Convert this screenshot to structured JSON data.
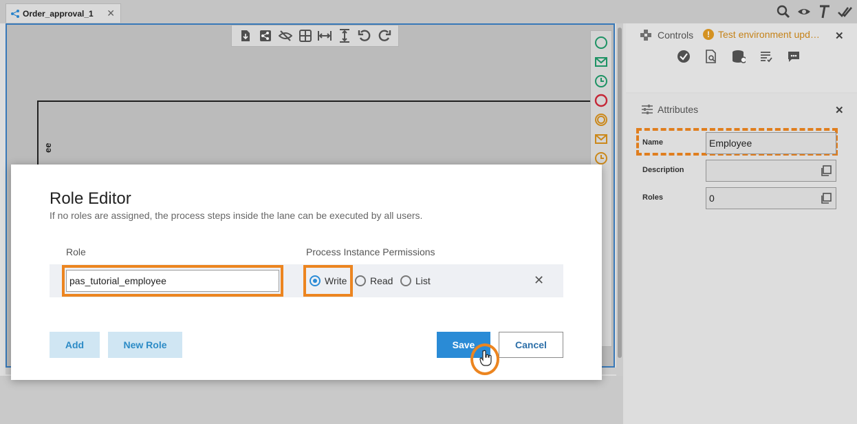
{
  "tab": {
    "title": "Order_approval_1",
    "close": "✕"
  },
  "canvas": {
    "lane_label": "ee"
  },
  "controls": {
    "title": "Controls",
    "notice": "Test environment upd…",
    "close": "✕"
  },
  "attributes": {
    "title": "Attributes",
    "close": "✕",
    "name_label": "Name",
    "name_value": "Employee",
    "description_label": "Description",
    "description_value": "",
    "roles_label": "Roles",
    "roles_value": "0"
  },
  "dialog": {
    "title": "Role Editor",
    "subtitle": "If no roles are assigned, the process steps inside the lane can be executed by all users.",
    "col_role": "Role",
    "col_permissions": "Process Instance Permissions",
    "role_value": "pas_tutorial_employee",
    "radio_write": "Write",
    "radio_read": "Read",
    "radio_list": "List",
    "selected_permission": "Write",
    "row_close": "✕",
    "btn_add": "Add",
    "btn_new_role": "New Role",
    "btn_save": "Save",
    "btn_cancel": "Cancel"
  },
  "colors": {
    "accent": "#2a8bd6",
    "highlight": "#ec8520",
    "warning": "#e09a24"
  }
}
